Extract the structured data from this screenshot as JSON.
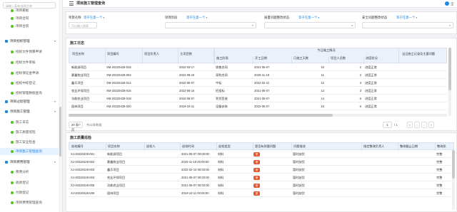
{
  "sidebar": {
    "search_placeholder": "请输入菜单/报表名称",
    "items": [
      {
        "label": "项目看板",
        "type": "sub"
      },
      {
        "label": "项目合同",
        "type": "sub"
      },
      {
        "label": "项目合同",
        "type": "sub"
      },
      {
        "label": "项目招标管理",
        "type": "group"
      },
      {
        "label": "招标文件预算申请",
        "type": "sub"
      },
      {
        "label": "招标文件审核",
        "type": "sub"
      },
      {
        "label": "招标保证金申请",
        "type": "sub"
      },
      {
        "label": "招标中标登记",
        "type": "sub"
      },
      {
        "label": "招标管理数据查询",
        "type": "sub"
      },
      {
        "label": "项目过程管理",
        "type": "group"
      },
      {
        "label": "项目施工管理",
        "type": "group"
      },
      {
        "label": "施工日志",
        "type": "sub"
      },
      {
        "label": "施工质量巡检",
        "type": "sub"
      },
      {
        "label": "施工安全检查",
        "type": "sub"
      },
      {
        "label": "项目施工管理查询",
        "type": "sub",
        "active": true
      },
      {
        "label": "项目费用管理",
        "type": "group"
      },
      {
        "label": "费用分析",
        "type": "sub"
      },
      {
        "label": "收款登记",
        "type": "sub"
      },
      {
        "label": "付款登记",
        "type": "sub"
      },
      {
        "label": "项目费用管理查询",
        "type": "sub"
      }
    ]
  },
  "topbar": {
    "title": "项目施工管理查询",
    "user": "全"
  },
  "filters": [
    {
      "label": "项目名称",
      "op": "等于任意一个",
      "placeholder": "可以输入搜索",
      "kind": "input"
    },
    {
      "label": "项目阶段",
      "op": "等于任意一个",
      "placeholder": "",
      "kind": "select"
    },
    {
      "label": "质量问题整改状态",
      "op": "等于任意一个",
      "placeholder": "",
      "kind": "select"
    },
    {
      "label": "安全问题整改状态",
      "op": "等于任意一个",
      "placeholder": "",
      "kind": "select"
    }
  ],
  "log_table": {
    "title": "施工日志",
    "group_header": "今日施工情况",
    "headers": [
      "项目名称",
      "项目编号",
      "项目负责人",
      "主项目数",
      "施工阶段",
      "开工日期",
      "已施工天数",
      "项目人员数",
      "进度状况",
      "当日施工记录及主要问题"
    ],
    "rows": [
      [
        "新能源项目",
        "XM-20220428-015",
        "",
        "2022-03-17",
        "销售合同",
        "2021-05-07",
        "10",
        "2",
        "进度正常"
      ],
      [
        "豪鑫物业项目",
        "XM-20220428-004",
        "",
        "2022-08-19",
        "采购合同",
        "2020-11-19",
        "11",
        "2",
        "进度正常"
      ],
      [
        "鑫乐项目",
        "XM-20220428-014",
        "",
        "2022-05-07",
        "中标",
        "2022-02-10",
        "12",
        "3",
        "进度正常"
      ],
      [
        "农业环保项目",
        "XM-20220428-016",
        "",
        "2022-08-19",
        "招投标",
        "2021-05-07",
        "13",
        "3",
        "进度正常"
      ],
      [
        "功能农业项目",
        "XM-20220428-018",
        "",
        "2022-05-07",
        "到货签收",
        "2021-05-07",
        "14",
        "6",
        "进度正常"
      ],
      [
        "园林项目",
        "XM-20220428-020",
        "",
        "2019-10-11",
        "设备安装",
        "2022-05-07",
        "15",
        "6",
        "进度正常"
      ]
    ],
    "pager": {
      "page_size": "20 条/页",
      "total": "共22条数据",
      "page": "1",
      "pages": "/ 1"
    }
  },
  "inspect_table": {
    "title": "施工质量巡检",
    "headers": [
      "巡检编号",
      "项目名称",
      "巡检人",
      "巡检时间",
      "巡检类型",
      "是否有质量问题",
      "问题描述",
      "指定整改负责人",
      "整改截止日期",
      "整改状"
    ],
    "rows": [
      [
        "XJ-20220428-001",
        "新能源项目",
        "",
        "2021-05-07 00:00:00",
        "材料",
        "是",
        "暂时缺货",
        "",
        "",
        "完整"
      ],
      [
        "XJ-20220428-002",
        "豪鑫物业项目",
        "",
        "2020-11-19 00:00:00",
        "材料",
        "是",
        "暂时缺货",
        "",
        "",
        "完整"
      ],
      [
        "XJ-20220428-003",
        "鑫乐项目",
        "",
        "2022-02-10 00:00:00",
        "材料",
        "是",
        "暂时缺货",
        "",
        "",
        "完整"
      ],
      [
        "XJ-20220428-004",
        "农业环保项目",
        "",
        "2021-05-07 00:00:00",
        "材料",
        "是",
        "暂时缺货",
        "",
        "",
        "完整"
      ],
      [
        "XJ-20220428-005",
        "功能农业项目",
        "",
        "2021-05-07 00:00:00",
        "材料",
        "是",
        "暂时缺货",
        "",
        "",
        "完整"
      ],
      [
        "XJ-20220428-006",
        "园林项目",
        "",
        "2019-10-11 00:00:00",
        "材料",
        "是",
        "暂时缺货",
        "",
        "",
        "完整"
      ]
    ]
  },
  "colors": {
    "accent": "#1e88e5",
    "tag_red": "#e8552a",
    "header_bg": "#eaf1fb"
  }
}
